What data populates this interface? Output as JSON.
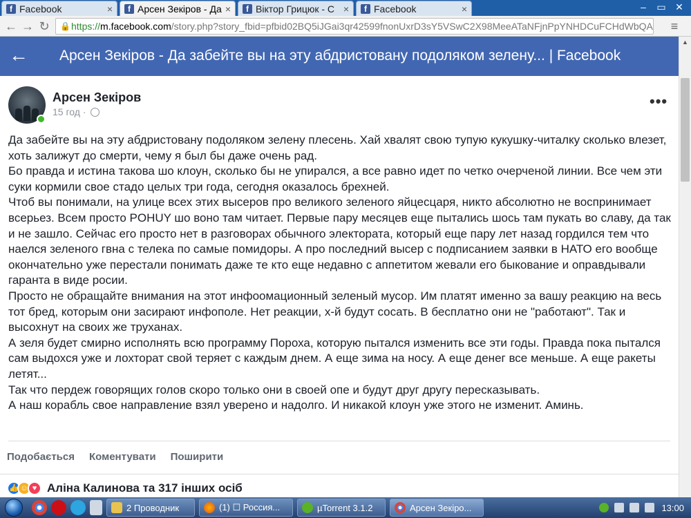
{
  "browser": {
    "tabs": [
      {
        "label": "Facebook",
        "favicon": "f"
      },
      {
        "label": "Арсен Зекіров - Да",
        "favicon": "f"
      },
      {
        "label": "Віктор Грицюк - С",
        "favicon": "f"
      },
      {
        "label": "Facebook",
        "favicon": "f"
      }
    ],
    "url_scheme": "https://",
    "url_host": "m.facebook.com",
    "url_path": "/story.php?story_fbid=pfbid02BQ5iJGai3qr42599fnonUxrD3sY5VSwC2X98MeeATaNFjnPpYNHDCuFCHdWbQA"
  },
  "header": {
    "title": "Арсен Зекіров - Да забейте вы на эту абдристовану подоляком зелену... | Facebook"
  },
  "post": {
    "author": "Арсен Зекіров",
    "time": "15 год",
    "paragraphs": [
      "Да забейте вы на эту абдристовану подоляком зелену плесень. Хай хвалят свою тупую кукушку-читалку сколько влезет, хоть залижут до смерти, чему я был бы даже очень рад.",
      "Бо правда и истина такова шо клоун, сколько бы не упирался, а все равно идет по четко очерченой линии. Все чем эти суки кормили свое стадо целых три года, сегодня оказалось брехней.",
      "Чтоб вы понимали, на улице всех этих высеров про великого зеленого яйцесцаря, никто абсолютно не воспринимает всерьез. Всем просто POHUY шо воно там читает. Первые пару месяцев еще пытались шось там пукать во славу, да так и не зашло. Сейчас его просто нет в разговорах обычного электората, который еще пару лет назад гордился тем что наелся зеленого гвна с телека по самые помидоры. А про последний высер с подписанием заявки в НАТО его вообще окончательно уже перестали понимать даже те кто еще недавно с аппетитом жевали его быкование и оправдывали гаранта в виде росии.",
      "Просто не обращайте внимания на этот инфоомационный зеленый мусор. Им платят именно за вашу реакцию на весь тот бред, которым они засирают инфополе. Нет реакции, х-й будут сосать. В бесплатно они не \"работают\". Так и высохнут на своих же труханах.",
      "А зеля будет смирно исполнять всю программу Пороха, которую пытался изменить все эти годы. Правда пока пытался сам выдохся уже и лохторат свой теряет с каждым днем. А еще зима на носу. А еще денег все меньше. А еще ракеты летят...",
      "Так что пердеж говорящих голов скоро только они в своей опе и будут друг другу пересказывать.",
      "А наш корабль свое направление взял уверено и надолго. И никакой клоун уже этого не изменит. Аминь."
    ],
    "actions": {
      "like": "Подобається",
      "comment": "Коментувати",
      "share": "Поширити"
    },
    "reactions_text": "Аліна Калинова та 317 інших осіб"
  },
  "taskbar": {
    "buttons": [
      {
        "label": "2 Проводник"
      },
      {
        "label": "(1) ☐ Россия..."
      },
      {
        "label": "µTorrent 3.1.2"
      },
      {
        "label": "Арсен Зекіро..."
      }
    ],
    "clock": "13:00"
  },
  "colors": {
    "fb_blue": "#4267b2",
    "taskbar": "#23406e"
  }
}
